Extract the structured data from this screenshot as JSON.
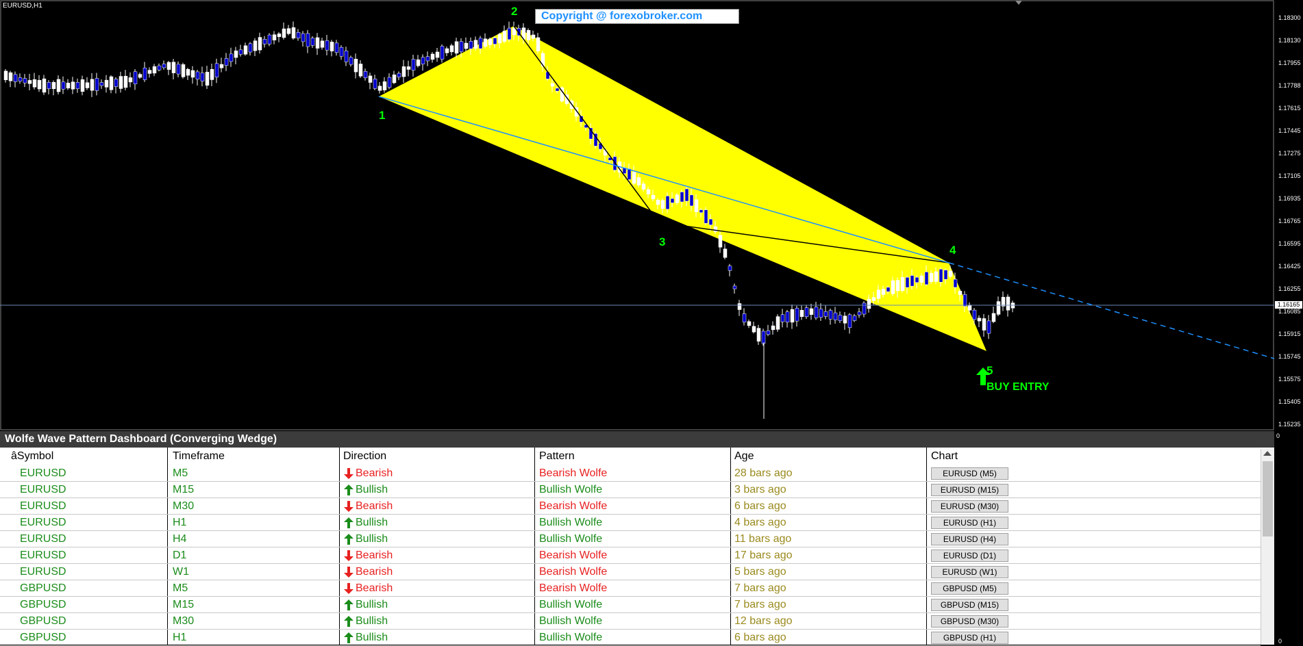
{
  "chart": {
    "symbol_title": "EURUSD,H1",
    "copyright": "Copyright @ forexobroker.com",
    "current_price": "1.16165",
    "price_labels": [
      "1.18300",
      "1.18130",
      "1.17955",
      "1.17788",
      "1.17615",
      "1.17445",
      "1.17275",
      "1.17105",
      "1.16935",
      "1.16765",
      "1.16595",
      "1.16425",
      "1.16255",
      "1.16085",
      "1.15915",
      "1.15745",
      "1.15575",
      "1.15405",
      "1.15235"
    ],
    "wave_labels": [
      "1",
      "2",
      "3",
      "4",
      "5"
    ],
    "buy_entry": "BUY ENTRY",
    "indicator_scale_zero": "0",
    "colors": {
      "wedge_fill": "#ffff00",
      "bull_candle": "#0000cd",
      "bear_candle": "#ffffff",
      "trendline": "#1e90ff",
      "wave_label": "#00ff00"
    }
  },
  "dashboard": {
    "title": "Wolfe Wave Pattern Dashboard (Converging Wedge)",
    "headers": {
      "symbol": "âSymbol",
      "timeframe": "Timeframe",
      "direction": "Direction",
      "pattern": "Pattern",
      "age": "Age",
      "chart": "Chart"
    },
    "rows": [
      {
        "symbol": "EURUSD",
        "timeframe": "M5",
        "direction": "Bearish",
        "dir_icon": "arrow-down-icon",
        "pattern": "Bearish Wolfe",
        "age": "28 bars ago",
        "chart": "EURUSD (M5)"
      },
      {
        "symbol": "EURUSD",
        "timeframe": "M15",
        "direction": "Bullish",
        "dir_icon": "arrow-up-icon",
        "pattern": "Bullish Wolfe",
        "age": "3 bars ago",
        "chart": "EURUSD (M15)"
      },
      {
        "symbol": "EURUSD",
        "timeframe": "M30",
        "direction": "Bearish",
        "dir_icon": "arrow-down-icon",
        "pattern": "Bearish Wolfe",
        "age": "6 bars ago",
        "chart": "EURUSD (M30)"
      },
      {
        "symbol": "EURUSD",
        "timeframe": "H1",
        "direction": "Bullish",
        "dir_icon": "arrow-up-icon",
        "pattern": "Bullish Wolfe",
        "age": "4 bars ago",
        "chart": "EURUSD (H1)"
      },
      {
        "symbol": "EURUSD",
        "timeframe": "H4",
        "direction": "Bullish",
        "dir_icon": "arrow-up-icon",
        "pattern": "Bullish Wolfe",
        "age": "11 bars ago",
        "chart": "EURUSD (H4)"
      },
      {
        "symbol": "EURUSD",
        "timeframe": "D1",
        "direction": "Bearish",
        "dir_icon": "arrow-down-icon",
        "pattern": "Bearish Wolfe",
        "age": "17 bars ago",
        "chart": "EURUSD (D1)"
      },
      {
        "symbol": "EURUSD",
        "timeframe": "W1",
        "direction": "Bearish",
        "dir_icon": "arrow-down-icon",
        "pattern": "Bearish Wolfe",
        "age": "5 bars ago",
        "chart": "EURUSD (W1)"
      },
      {
        "symbol": "GBPUSD",
        "timeframe": "M5",
        "direction": "Bearish",
        "dir_icon": "arrow-down-icon",
        "pattern": "Bearish Wolfe",
        "age": "7 bars ago",
        "chart": "GBPUSD (M5)"
      },
      {
        "symbol": "GBPUSD",
        "timeframe": "M15",
        "direction": "Bullish",
        "dir_icon": "arrow-up-icon",
        "pattern": "Bullish Wolfe",
        "age": "7 bars ago",
        "chart": "GBPUSD (M15)"
      },
      {
        "symbol": "GBPUSD",
        "timeframe": "M30",
        "direction": "Bullish",
        "dir_icon": "arrow-up-icon",
        "pattern": "Bullish Wolfe",
        "age": "12 bars ago",
        "chart": "GBPUSD (M30)"
      },
      {
        "symbol": "GBPUSD",
        "timeframe": "H1",
        "direction": "Bullish",
        "dir_icon": "arrow-up-icon",
        "pattern": "Bullish Wolfe",
        "age": "6 bars ago",
        "chart": "GBPUSD (H1)"
      }
    ],
    "indicator_scale_zero": "0"
  }
}
